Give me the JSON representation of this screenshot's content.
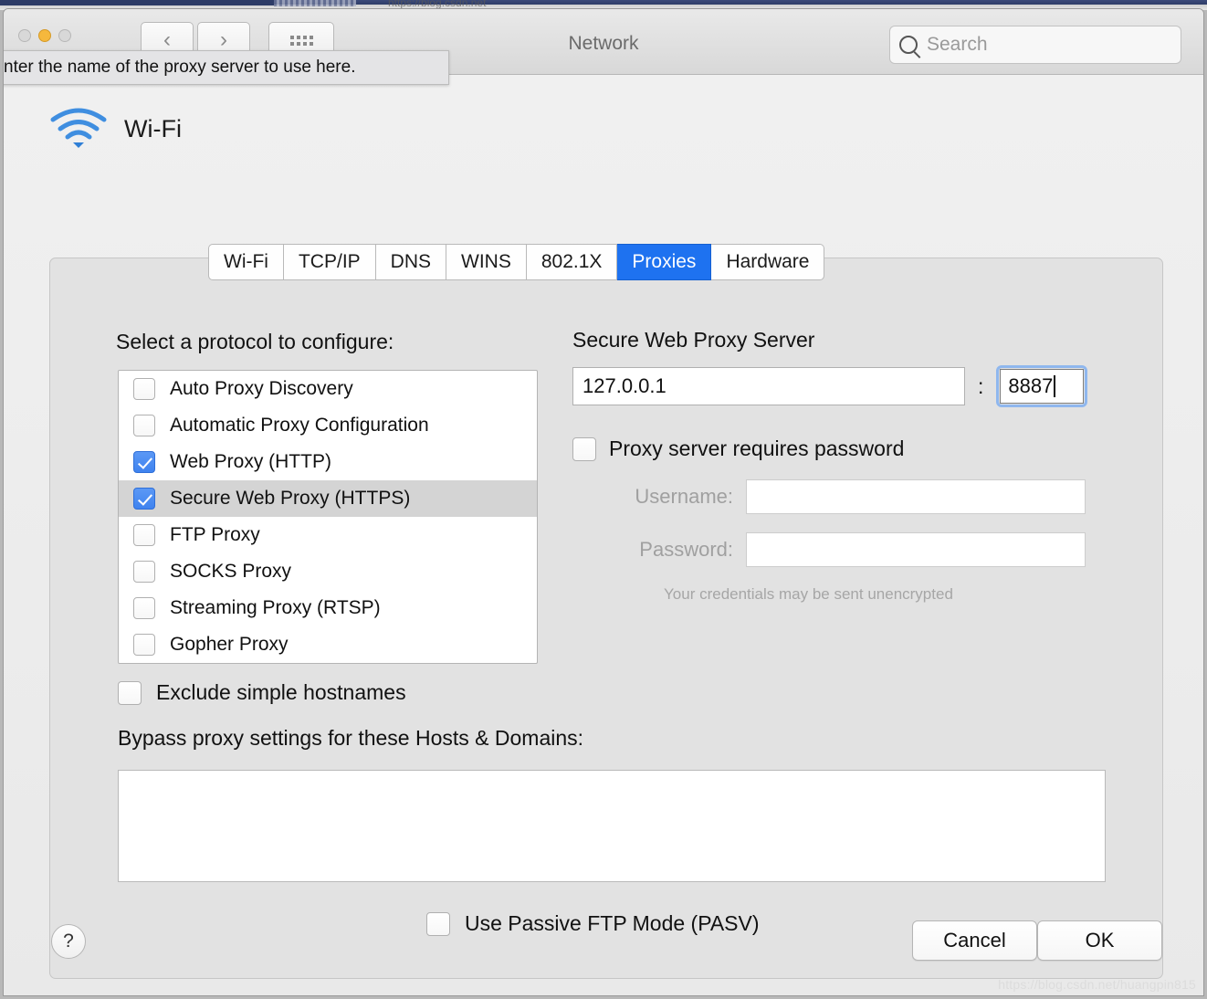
{
  "background": {
    "browser_url_hint": "https://blog.csdn.net"
  },
  "window": {
    "title": "Network",
    "traffic_lights": [
      "close",
      "minimize",
      "zoom"
    ],
    "nav": {
      "back": "‹",
      "forward": "›",
      "show_all": "grid-icon"
    }
  },
  "search": {
    "placeholder": "Search",
    "value": ""
  },
  "tooltip": {
    "text": "nter the name of the proxy server to use here."
  },
  "interface": {
    "name": "Wi-Fi",
    "icon": "wifi-icon",
    "icon_color": "#3f8ee0"
  },
  "tabs": [
    {
      "label": "Wi-Fi",
      "active": false
    },
    {
      "label": "TCP/IP",
      "active": false
    },
    {
      "label": "DNS",
      "active": false
    },
    {
      "label": "WINS",
      "active": false
    },
    {
      "label": "802.1X",
      "active": false
    },
    {
      "label": "Proxies",
      "active": true
    },
    {
      "label": "Hardware",
      "active": false
    }
  ],
  "accent_color": "#1e72f0",
  "checkbox_color": "#4a8ef0",
  "protocols": {
    "heading": "Select a protocol to configure:",
    "items": [
      {
        "label": "Auto Proxy Discovery",
        "checked": false,
        "selected": false
      },
      {
        "label": "Automatic Proxy Configuration",
        "checked": false,
        "selected": false
      },
      {
        "label": "Web Proxy (HTTP)",
        "checked": true,
        "selected": false
      },
      {
        "label": "Secure Web Proxy (HTTPS)",
        "checked": true,
        "selected": true
      },
      {
        "label": "FTP Proxy",
        "checked": false,
        "selected": false
      },
      {
        "label": "SOCKS Proxy",
        "checked": false,
        "selected": false
      },
      {
        "label": "Streaming Proxy (RTSP)",
        "checked": false,
        "selected": false
      },
      {
        "label": "Gopher Proxy",
        "checked": false,
        "selected": false
      }
    ]
  },
  "exclude_simple_hostnames": {
    "label": "Exclude simple hostnames",
    "checked": false
  },
  "bypass": {
    "label": "Bypass proxy settings for these Hosts & Domains:",
    "value": ""
  },
  "passive_ftp": {
    "label": "Use Passive FTP Mode (PASV)",
    "checked": false
  },
  "server": {
    "title": "Secure Web Proxy Server",
    "host": "127.0.0.1",
    "host_placeholder": "",
    "separator": ":",
    "port": "8887",
    "port_focused": true
  },
  "auth": {
    "requires_password_label": "Proxy server requires password",
    "requires_password_checked": false,
    "username_label": "Username:",
    "username_value": "",
    "password_label": "Password:",
    "password_value": "",
    "note": "Your credentials may be sent unencrypted"
  },
  "footer": {
    "help": "?",
    "cancel_label": "Cancel",
    "ok_label": "OK"
  },
  "watermark": "https://blog.csdn.net/huangpin815"
}
